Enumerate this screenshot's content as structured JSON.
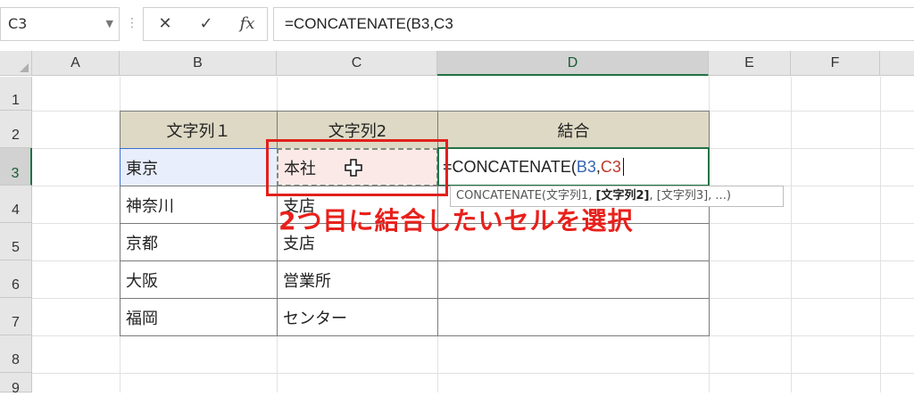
{
  "formula_bar": {
    "name_box": "C3",
    "cancel_symbol": "✕",
    "enter_symbol": "✓",
    "fx_label": "fx",
    "formula": "=CONCATENATE(B3,C3"
  },
  "columns": [
    "A",
    "B",
    "C",
    "D",
    "E",
    "F"
  ],
  "selected_column": "D",
  "rows": [
    "1",
    "2",
    "3",
    "4",
    "5",
    "6",
    "7",
    "8",
    "9"
  ],
  "selected_row": "3",
  "table": {
    "headers": [
      "文字列１",
      "文字列2",
      "結合"
    ],
    "rows": [
      [
        "東京",
        "本社",
        ""
      ],
      [
        "神奈川",
        "支店",
        ""
      ],
      [
        "京都",
        "支店",
        ""
      ],
      [
        "大阪",
        "営業所",
        ""
      ],
      [
        "福岡",
        "センター",
        ""
      ]
    ]
  },
  "editing_cell": {
    "prefix": "=CONCATENATE(",
    "ref1": "B3",
    "comma": ",",
    "ref2": "C3"
  },
  "tooltip": {
    "func": "CONCATENATE(",
    "arg1": "文字列1, ",
    "arg2_bold": "[文字列2]",
    "rest": ", [文字列3], ...)"
  },
  "callout_text": "2つ目に結合したいセルを選択",
  "colors": {
    "accent_green": "#217346",
    "annotation_red": "#e0201c",
    "header_fill": "#ded9c4",
    "ref_blue": "#3665b3",
    "ref_red": "#c0392b"
  }
}
